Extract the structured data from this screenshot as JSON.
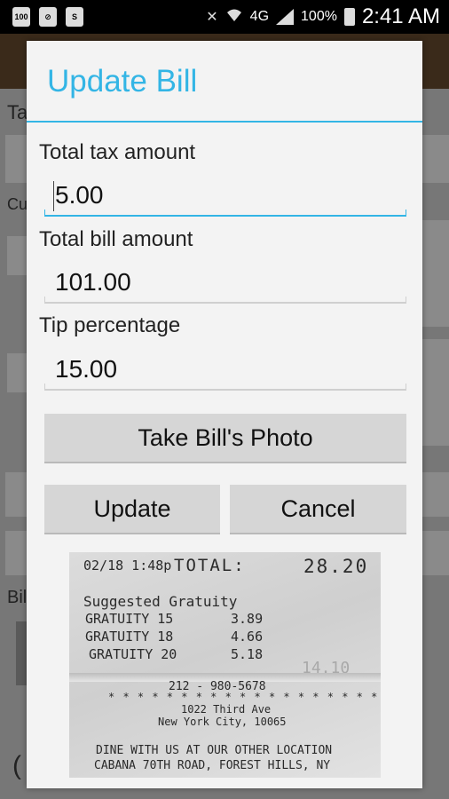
{
  "status_bar": {
    "left_icons": [
      "app-notification-icon",
      "search-notification-icon",
      "skype-icon"
    ],
    "left_icon_glyphs": [
      "100",
      "⊘",
      "S"
    ],
    "network": "4G",
    "battery": "100%",
    "time": "2:41 AM"
  },
  "background": {
    "partial_texts": [
      "Ta",
      "Cu",
      "Bil",
      "("
    ]
  },
  "dialog": {
    "title": "Update Bill",
    "fields": [
      {
        "label": "Total tax amount",
        "value": "5.00"
      },
      {
        "label": "Total bill amount",
        "value": "101.00"
      },
      {
        "label": "Tip percentage",
        "value": "15.00"
      }
    ],
    "photo_button": "Take Bill's Photo",
    "update_button": "Update",
    "cancel_button": "Cancel"
  },
  "receipt": {
    "date_time": "02/18  1:48p",
    "total_label": "TOTAL:",
    "total_value": "28.20",
    "suggested": "Suggested Gratuity",
    "gratuities": [
      {
        "label": "GRATUITY 15",
        "value": "3.89"
      },
      {
        "label": "GRATUITY 18",
        "value": "4.66"
      },
      {
        "label": "GRATUITY 20",
        "value": "5.18"
      }
    ],
    "faint_value": "14.10",
    "phone": "212 - 980-5678",
    "stars": "* * * * * * * * * * * * * * * * * * * * * * * *",
    "address_1": "1022 Third Ave",
    "address_2": "New York City, 10065",
    "dine_line": "DINE WITH US AT OUR OTHER LOCATION",
    "cabana_line": "CABANA 70TH ROAD, FOREST HILLS, NY"
  },
  "colors": {
    "accent": "#33b5e5",
    "dialog_bg": "#f3f3f3",
    "button_bg": "#d6d6d6"
  }
}
